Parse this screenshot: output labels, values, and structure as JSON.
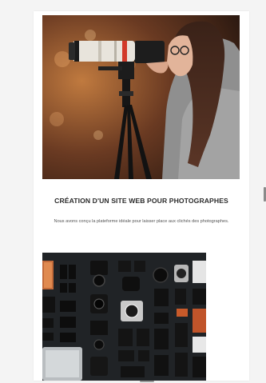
{
  "card": {
    "title": "CRÉATION D'UN SITE WEB POUR PHOTOGRAPHES",
    "description": "Nous avons conçu la plateforme idéale pour laisser place aux clichés des photographes."
  },
  "images": {
    "hero": "photographer-with-camera-image",
    "gear": "camera-gear-flatlay-image"
  },
  "colors": {
    "page_bg": "#f4f4f4",
    "card_bg": "#ffffff",
    "title": "#2b2b2b",
    "text": "#555555"
  }
}
